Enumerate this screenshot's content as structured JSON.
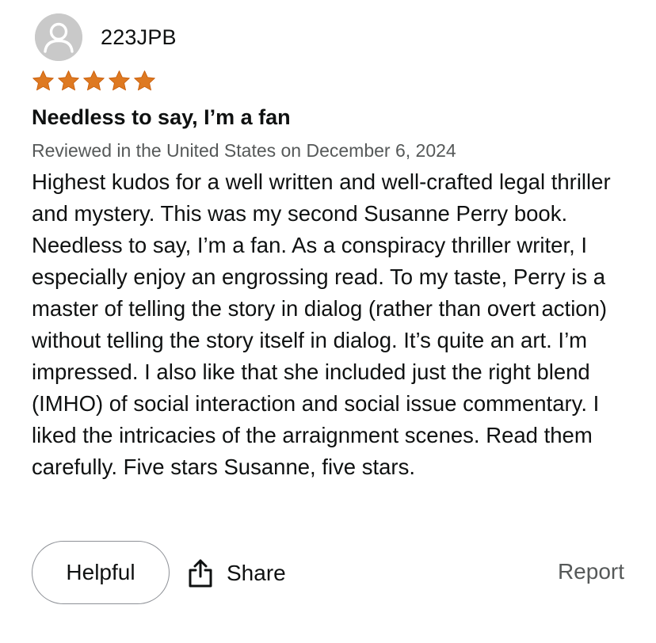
{
  "reviewer": {
    "name": "223JPB",
    "avatar_icon": "default-user-avatar-icon"
  },
  "rating": {
    "stars": 5,
    "max": 5,
    "color": "#de7921",
    "icon": "star-icon"
  },
  "review": {
    "title": "Needless to say, I’m a fan",
    "meta": "Reviewed in the United States on December 6, 2024",
    "body": "Highest kudos for a well written and well-crafted legal thriller and mystery. This was my second Susanne Perry book. Needless to say, I’m a fan. As a conspiracy thriller writer, I especially enjoy an engrossing read. To my taste, Perry is a master of telling the story in dialog (rather than overt action) without telling the story itself in dialog. It’s quite an art. I’m impressed. I also like that she included just the right blend (IMHO) of social interaction and social issue commentary. I liked the intricacies of the arraignment scenes. Read them carefully. Five stars Susanne, five stars."
  },
  "actions": {
    "helpful_label": "Helpful",
    "share_label": "Share",
    "share_icon": "share-icon",
    "report_label": "Report"
  }
}
